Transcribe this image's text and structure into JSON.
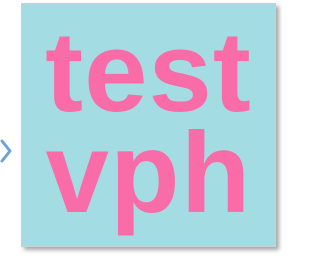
{
  "thumbnail": {
    "lines": [
      "test",
      "vph"
    ],
    "background_color": "#a3dde3",
    "text_color": "#f96ca7",
    "border_color": "#c9cfd5"
  },
  "left_indicator": {
    "icon": "chevron-right-icon",
    "color": "#6ea3d6"
  }
}
